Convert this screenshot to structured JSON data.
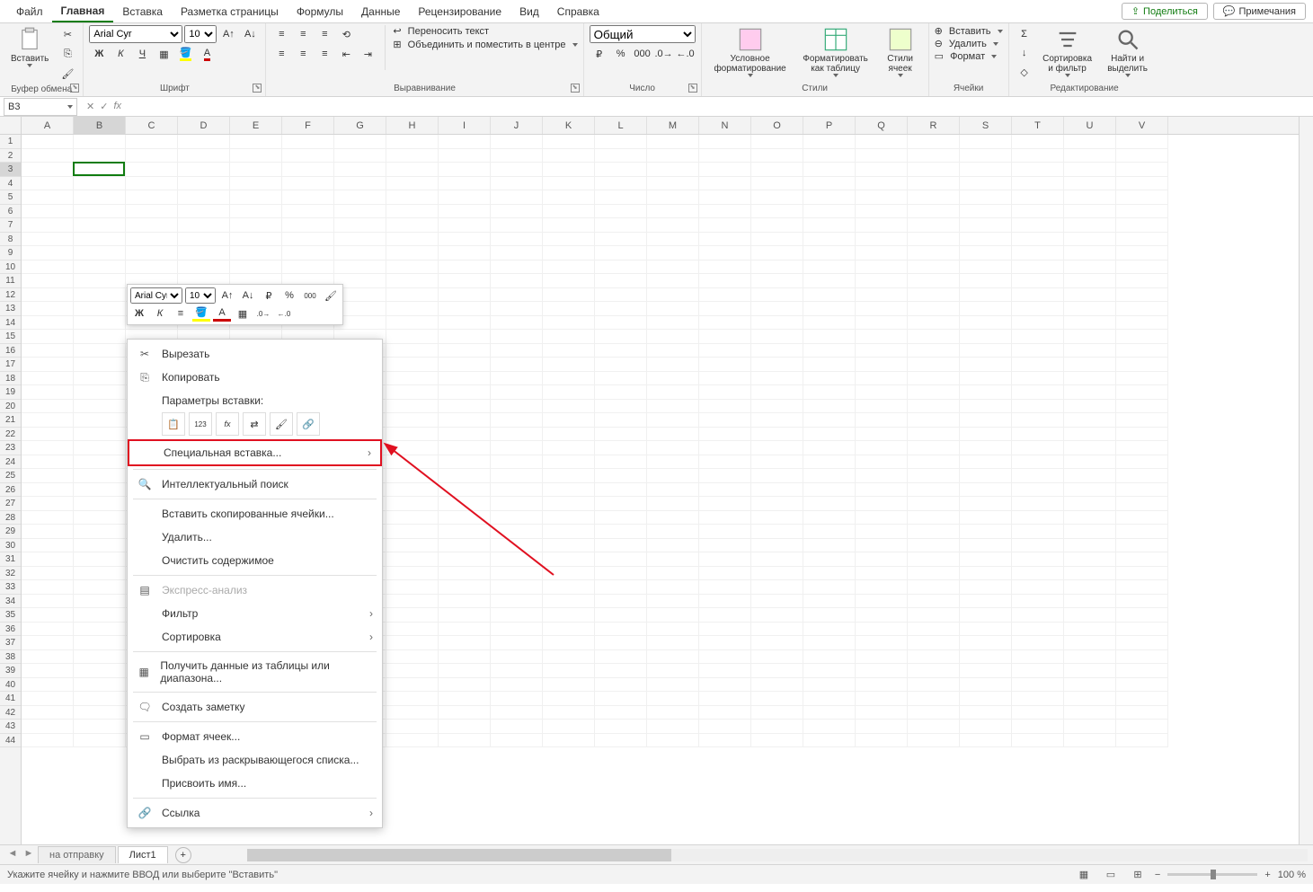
{
  "menubar": {
    "tabs": [
      "Файл",
      "Главная",
      "Вставка",
      "Разметка страницы",
      "Формулы",
      "Данные",
      "Рецензирование",
      "Вид",
      "Справка"
    ],
    "active_index": 1,
    "share": "Поделиться",
    "comments": "Примечания"
  },
  "ribbon": {
    "clipboard": {
      "paste": "Вставить",
      "label": "Буфер обмена"
    },
    "font": {
      "name": "Arial Cyr",
      "size": "10",
      "label": "Шрифт"
    },
    "alignment": {
      "wrap": "Переносить текст",
      "merge": "Объединить и поместить в центре",
      "label": "Выравнивание"
    },
    "number": {
      "format": "Общий",
      "label": "Число"
    },
    "styles": {
      "cond": "Условное форматирование",
      "table": "Форматировать как таблицу",
      "cellstyles": "Стили ячеек",
      "label": "Стили"
    },
    "cells": {
      "insert": "Вставить",
      "delete": "Удалить",
      "format": "Формат",
      "label": "Ячейки"
    },
    "editing": {
      "sort": "Сортировка и фильтр",
      "find": "Найти и выделить",
      "label": "Редактирование"
    }
  },
  "namebox": "B3",
  "columns": [
    "A",
    "B",
    "C",
    "D",
    "E",
    "F",
    "G",
    "H",
    "I",
    "J",
    "K",
    "L",
    "M",
    "N",
    "O",
    "P",
    "Q",
    "R",
    "S",
    "T",
    "U",
    "V"
  ],
  "rows_count": 44,
  "selected": {
    "col": "B",
    "row": 3,
    "col_index": 1,
    "row_index": 2
  },
  "minitoolbar": {
    "font": "Arial Cyr",
    "size": "10"
  },
  "contextmenu": {
    "cut": "Вырезать",
    "copy": "Копировать",
    "paste_options_label": "Параметры вставки:",
    "special_paste": "Специальная вставка...",
    "smart_lookup": "Интеллектуальный поиск",
    "insert_copied": "Вставить скопированные ячейки...",
    "delete": "Удалить...",
    "clear": "Очистить содержимое",
    "quick_analysis": "Экспресс-анализ",
    "filter": "Фильтр",
    "sort": "Сортировка",
    "get_data": "Получить данные из таблицы или диапазона...",
    "new_note": "Создать заметку",
    "format_cells": "Формат ячеек...",
    "dropdown_list": "Выбрать из раскрывающегося списка...",
    "define_name": "Присвоить имя...",
    "link": "Ссылка"
  },
  "sheettabs": {
    "tabs": [
      "на отправку",
      "Лист1"
    ],
    "active_index": 1
  },
  "statusbar": {
    "message": "Укажите ячейку и нажмите ВВОД или выберите \"Вставить\"",
    "zoom": "100 %"
  }
}
